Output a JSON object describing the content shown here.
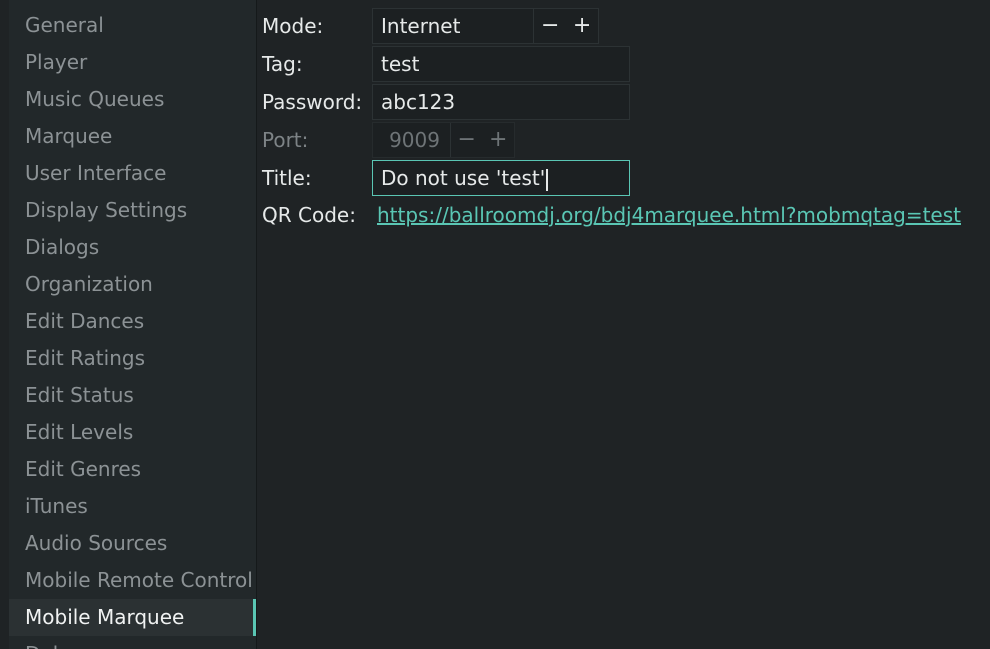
{
  "sidebar": {
    "items": [
      {
        "label": "General"
      },
      {
        "label": "Player"
      },
      {
        "label": "Music Queues"
      },
      {
        "label": "Marquee"
      },
      {
        "label": "User Interface"
      },
      {
        "label": "Display Settings"
      },
      {
        "label": "Dialogs"
      },
      {
        "label": "Organization"
      },
      {
        "label": "Edit Dances"
      },
      {
        "label": "Edit Ratings"
      },
      {
        "label": "Edit Status"
      },
      {
        "label": "Edit Levels"
      },
      {
        "label": "Edit Genres"
      },
      {
        "label": "iTunes"
      },
      {
        "label": "Audio Sources"
      },
      {
        "label": "Mobile Remote Control"
      },
      {
        "label": "Mobile Marquee",
        "selected": true
      },
      {
        "label": "Debug"
      }
    ]
  },
  "form": {
    "mode": {
      "label": "Mode:",
      "value": "Internet",
      "decrement": "−",
      "increment": "+"
    },
    "tag": {
      "label": "Tag:",
      "value": "test"
    },
    "password": {
      "label": "Password:",
      "value": "abc123"
    },
    "port": {
      "label": "Port:",
      "value": "9009",
      "decrement": "−",
      "increment": "+",
      "disabled": true
    },
    "title": {
      "label": "Title:",
      "value": "Do not use 'test'"
    },
    "qr_code": {
      "label": "QR Code:",
      "url": "https://ballroomdj.org/bdj4marquee.html?mobmqtag=test"
    }
  },
  "colors": {
    "accent": "#5ac6b4",
    "background": "#1f2325",
    "sidebar": "#22282a"
  }
}
